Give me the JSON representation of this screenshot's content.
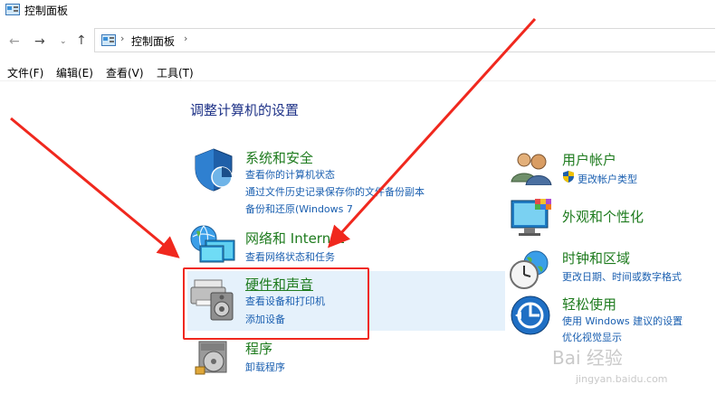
{
  "window": {
    "title": "控制面板"
  },
  "address": {
    "path": "控制面板"
  },
  "menu": [
    "文件(F)",
    "编辑(E)",
    "查看(V)",
    "工具(T)"
  ],
  "main": {
    "heading": "调整计算机的设置",
    "left_categories": [
      {
        "title": "系统和安全",
        "links": [
          "查看你的计算机状态",
          "通过文件历史记录保存你的文件备份副本",
          "备份和还原(Windows 7"
        ]
      },
      {
        "title": "网络和 Internet",
        "links": [
          "查看网络状态和任务"
        ]
      },
      {
        "title": "硬件和声音",
        "links": [
          "查看设备和打印机",
          "添加设备"
        ]
      },
      {
        "title": "程序",
        "links": [
          "卸载程序"
        ]
      }
    ],
    "right_categories": [
      {
        "title": "用户帐户",
        "links": [
          "更改帐户类型"
        ]
      },
      {
        "title": "外观和个性化",
        "links": []
      },
      {
        "title": "时钟和区域",
        "links": [
          "更改日期、时间或数字格式"
        ]
      },
      {
        "title": "轻松使用",
        "links": [
          "使用 Windows 建议的设置",
          "优化视觉显示"
        ]
      }
    ]
  },
  "watermark": {
    "text": "Bai 经验",
    "sub": "jingyan.baidu.com"
  },
  "colors": {
    "category_title": "#1e7b1e",
    "link": "#1a5fb0",
    "heading": "#1e3287",
    "arrow": "#f0281e",
    "hover_bg": "#e5f1fb"
  }
}
